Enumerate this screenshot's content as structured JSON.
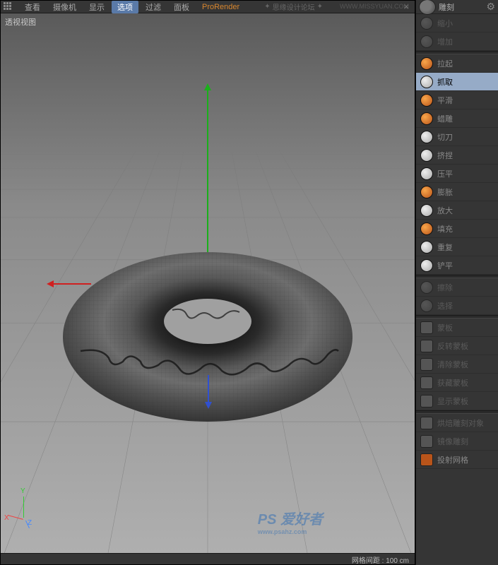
{
  "menu": {
    "items": [
      "查看",
      "摄像机",
      "显示",
      "选项",
      "过滤",
      "面板",
      "ProRender"
    ],
    "highlighted_index": 3,
    "pro_index": 6
  },
  "viewport": {
    "label": "透视视图",
    "axis_labels": {
      "x": "X",
      "y": "Y",
      "z": "Z"
    }
  },
  "status": {
    "grid_spacing_label": "网格间距 :",
    "grid_spacing_value": "100 cm"
  },
  "panel": {
    "header_label": "雕刻",
    "tools_group1": [
      {
        "label": "缩小",
        "variant": "gray",
        "dim": true
      },
      {
        "label": "增加",
        "variant": "gray",
        "dim": true
      }
    ],
    "tools_group2": [
      {
        "label": "拉起",
        "variant": "orange"
      },
      {
        "label": "抓取",
        "variant": "white",
        "active": true
      },
      {
        "label": "平滑",
        "variant": "orange"
      },
      {
        "label": "蜡雕",
        "variant": "orange"
      },
      {
        "label": "切刀",
        "variant": "white"
      },
      {
        "label": "挤捏",
        "variant": "white"
      },
      {
        "label": "压平",
        "variant": "white"
      },
      {
        "label": "膨胀",
        "variant": "orange"
      },
      {
        "label": "放大",
        "variant": "white"
      },
      {
        "label": "填充",
        "variant": "orange"
      },
      {
        "label": "重复",
        "variant": "white"
      },
      {
        "label": "铲平",
        "variant": "white"
      }
    ],
    "tools_group3": [
      {
        "label": "擦除",
        "dim": true
      },
      {
        "label": "选择",
        "dim": true
      }
    ],
    "tools_group4": [
      {
        "label": "蒙板",
        "dim": true
      },
      {
        "label": "反转蒙板",
        "dim": true
      },
      {
        "label": "清除蒙板",
        "dim": true
      },
      {
        "label": "获藏蒙板",
        "dim": true
      },
      {
        "label": "显示蒙板",
        "dim": true
      }
    ],
    "tools_group5": [
      {
        "label": "烘焙雕刻对象",
        "dim": true
      },
      {
        "label": "镜像雕刻",
        "dim": true
      },
      {
        "label": "投射网格",
        "variant": "orange-sq"
      }
    ]
  },
  "watermark": {
    "forum_text": "思缘设计论坛",
    "url_text": "WWW.MISSYUAN.COM",
    "bottom_text": "PS 爱好者",
    "bottom_url": "www.psahz.com"
  }
}
